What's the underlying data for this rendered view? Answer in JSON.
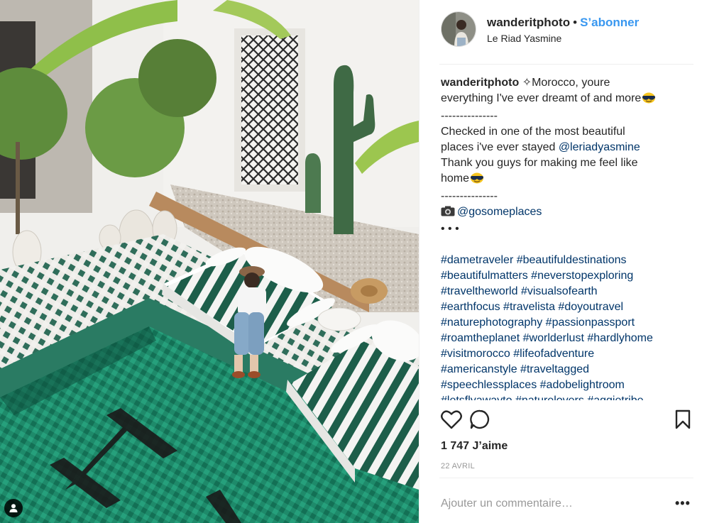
{
  "post": {
    "username": "wanderitphoto",
    "separator": "•",
    "follow_label": "S’abonner",
    "location": "Le Riad Yasmine"
  },
  "caption": {
    "username": "wanderitphoto",
    "line1": " ✧Morocco, youre",
    "line2": "everything I've ever dreamt of and more",
    "divider": "---------------",
    "line3": "Checked in one of the most beautiful",
    "line4_prefix": "places i've ever stayed ",
    "mention1": "@leriadyasmine",
    "line5": "Thank you guys for making me feel like",
    "line6": "home",
    "camera_mention": "@gosomeplaces",
    "dots": "• • •",
    "hashtag_lines": [
      "#dametraveler #beautifuldestinations",
      "#beautifulmatters #neverstopexploring",
      "#traveltheworld #visualsofearth",
      "#earthfocus #travelista #doyoutravel",
      "#naturephotography #passionpassport",
      "#roamtheplanet #worlderlust #hardlyhome",
      "#visitmorocco #lifeofadventure",
      "#americanstyle #traveltagged",
      "#speechlessplaces #adobelightroom",
      "#letsflyawayto #naturelovers #aggietribe"
    ]
  },
  "stats": {
    "likes": "1 747 J’aime",
    "date": "22 AVRIL"
  },
  "comment": {
    "placeholder": "Ajouter un commentaire…",
    "more": "•••"
  },
  "icons": {
    "like": "heart-outline-icon",
    "comment": "speech-bubble-icon",
    "save": "bookmark-icon",
    "tag": "person-tag-icon",
    "camera": "camera-icon",
    "emoji": "sunglasses-emoji-icon"
  },
  "colors": {
    "follow": "#3897f0",
    "link": "#003569",
    "text": "#262626",
    "muted": "#999999",
    "pool_green": "#1f6f5a"
  }
}
